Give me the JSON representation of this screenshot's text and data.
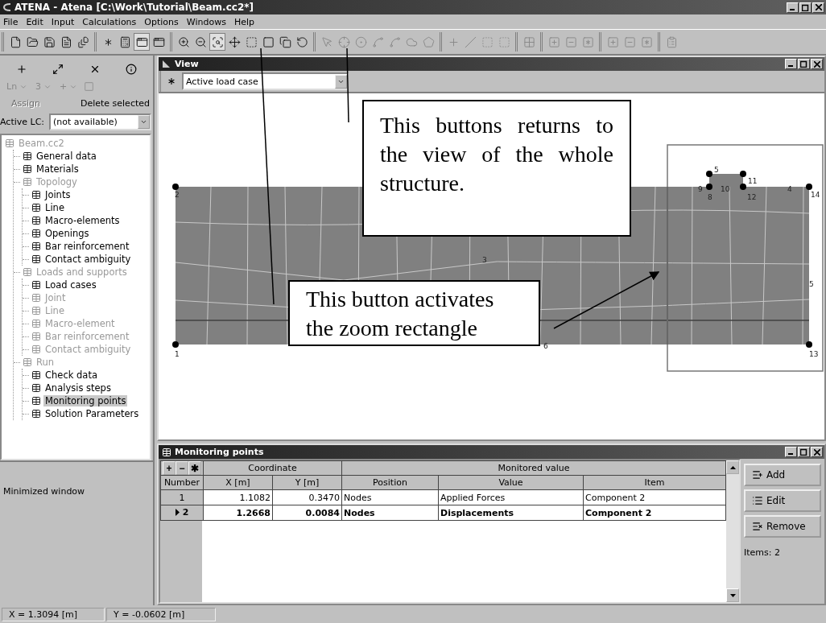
{
  "window": {
    "title": "ATENA - Atena [C:\\Work\\Tutorial\\Beam.cc2*]"
  },
  "menu": [
    "File",
    "Edit",
    "Input",
    "Calculations",
    "Options",
    "Windows",
    "Help"
  ],
  "toolbar": [
    {
      "buttons": [
        {
          "pressed": false,
          "disabled": false
        },
        {
          "pressed": false,
          "disabled": false
        },
        {
          "pressed": false,
          "disabled": false
        },
        {
          "pressed": false,
          "disabled": false
        },
        {
          "pressed": false,
          "disabled": false
        }
      ]
    },
    {
      "buttons": [
        {
          "pressed": false,
          "disabled": false
        },
        {
          "pressed": false,
          "disabled": false
        },
        {
          "pressed": true,
          "disabled": false
        },
        {
          "pressed": false,
          "disabled": false
        }
      ]
    },
    {
      "buttons": [
        {
          "pressed": false,
          "disabled": false
        },
        {
          "pressed": false,
          "disabled": false
        },
        {
          "pressed": true,
          "disabled": false
        },
        {
          "pressed": false,
          "disabled": false
        },
        {
          "pressed": false,
          "disabled": false
        },
        {
          "pressed": false,
          "disabled": false
        },
        {
          "pressed": false,
          "disabled": false
        },
        {
          "pressed": false,
          "disabled": false
        }
      ]
    },
    {
      "buttons": [
        {
          "pressed": false,
          "disabled": true
        },
        {
          "pressed": false,
          "disabled": true
        },
        {
          "pressed": false,
          "disabled": true
        },
        {
          "pressed": false,
          "disabled": true
        },
        {
          "pressed": false,
          "disabled": true
        },
        {
          "pressed": false,
          "disabled": true
        },
        {
          "pressed": false,
          "disabled": true
        }
      ]
    },
    {
      "buttons": [
        {
          "pressed": false,
          "disabled": true
        },
        {
          "pressed": false,
          "disabled": true
        },
        {
          "pressed": false,
          "disabled": true
        },
        {
          "pressed": false,
          "disabled": true
        }
      ]
    },
    {
      "buttons": [
        {
          "pressed": false,
          "disabled": true
        }
      ]
    },
    {
      "buttons": [
        {
          "pressed": false,
          "disabled": true
        },
        {
          "pressed": false,
          "disabled": true
        },
        {
          "pressed": false,
          "disabled": true
        }
      ]
    },
    {
      "buttons": [
        {
          "pressed": false,
          "disabled": true
        },
        {
          "pressed": false,
          "disabled": true
        },
        {
          "pressed": false,
          "disabled": true
        }
      ]
    },
    {
      "buttons": [
        {
          "pressed": false,
          "disabled": true
        }
      ]
    }
  ],
  "left_panel": {
    "selectors": [
      {
        "text": "Ln"
      },
      {
        "text": "3"
      },
      {
        "text": "+"
      }
    ],
    "assign": {
      "label": "Assign",
      "disabled": true
    },
    "delete": {
      "label": "Delete selected",
      "disabled": false
    },
    "active_lc": {
      "label": "Active LC:",
      "value": "(not available)"
    },
    "tree": [
      {
        "label": "Beam.cc2",
        "disabled": true,
        "selected": false,
        "children": [
          {
            "label": "General data",
            "disabled": false,
            "selected": false
          },
          {
            "label": "Materials",
            "disabled": false,
            "selected": false
          },
          {
            "label": "Topology",
            "disabled": true,
            "selected": false,
            "children": [
              {
                "label": "Joints",
                "disabled": false,
                "selected": false
              },
              {
                "label": "Line",
                "disabled": false,
                "selected": false
              },
              {
                "label": "Macro-elements",
                "disabled": false,
                "selected": false
              },
              {
                "label": "Openings",
                "disabled": false,
                "selected": false
              },
              {
                "label": "Bar reinforcement",
                "disabled": false,
                "selected": false
              },
              {
                "label": "Contact ambiguity",
                "disabled": false,
                "selected": false
              }
            ]
          },
          {
            "label": "Loads and supports",
            "disabled": true,
            "selected": false,
            "children": [
              {
                "label": "Load cases",
                "disabled": false,
                "selected": false
              },
              {
                "label": "Joint",
                "disabled": true,
                "selected": false
              },
              {
                "label": "Line",
                "disabled": true,
                "selected": false
              },
              {
                "label": "Macro-element",
                "disabled": true,
                "selected": false
              },
              {
                "label": "Bar reinforcement",
                "disabled": true,
                "selected": false
              },
              {
                "label": "Contact ambiguity",
                "disabled": true,
                "selected": false
              }
            ]
          },
          {
            "label": "Run",
            "disabled": true,
            "selected": false,
            "children": [
              {
                "label": "Check data",
                "disabled": false,
                "selected": false
              },
              {
                "label": "Analysis steps",
                "disabled": false,
                "selected": false
              },
              {
                "label": "Monitoring points",
                "disabled": false,
                "selected": true
              },
              {
                "label": "Solution Parameters",
                "disabled": false,
                "selected": false
              }
            ]
          }
        ]
      }
    ],
    "minimized": "Minimized window"
  },
  "view": {
    "title": "View",
    "load_case": "Active load case",
    "node_labels": [
      "5",
      "2",
      "9",
      "10",
      "11",
      "4",
      "14",
      "8",
      "12",
      "3",
      "5",
      "6",
      "1",
      "13"
    ],
    "callouts": [
      "This buttons returns to the view of the whole structure.",
      "This button activates the zoom rectangle"
    ]
  },
  "monitoring": {
    "title": "Monitoring points",
    "tools": [
      "+",
      "−",
      "✱"
    ],
    "groups": [
      "Coordinate",
      "Monitored value"
    ],
    "columns": [
      "Number",
      "X [m]",
      "Y [m]",
      "Position",
      "Value",
      "Item"
    ],
    "rows": [
      {
        "selected": false,
        "cells": [
          "1",
          "1.1082",
          "0.3470",
          "Nodes",
          "Applied Forces",
          "Component 2"
        ]
      },
      {
        "selected": true,
        "cells": [
          "2",
          "1.2668",
          "0.0084",
          "Nodes",
          "Displacements",
          "Component 2"
        ]
      }
    ],
    "buttons": [
      "Add",
      "Edit",
      "Remove"
    ],
    "count": "Items: 2"
  },
  "status_bar": [
    "X = 1.3094 [m]",
    "Y = -0.0602 [m]"
  ]
}
